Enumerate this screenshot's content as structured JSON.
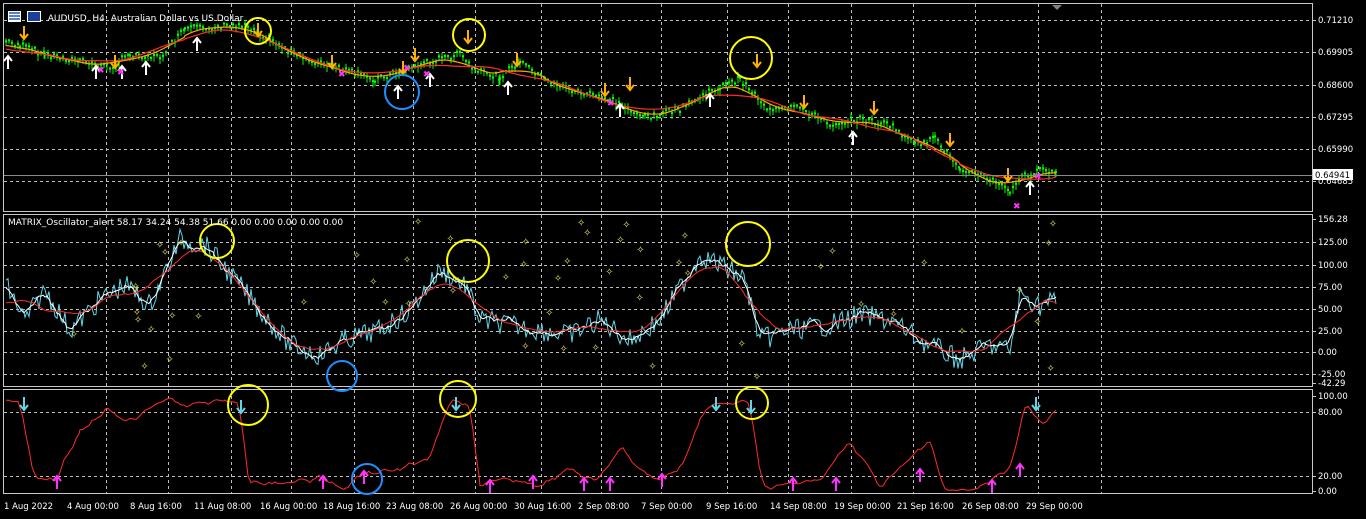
{
  "window": {
    "symbol_title": "AUDUSD, H4:  Australian Dollar vs US Dollar",
    "oscillator_title": "MATRIX_Oscillator_alert 58.17 34.24 54.38 51.66 0.00 0.00 0.00 0.00 0.00",
    "current_price": "0.64941"
  },
  "colors": {
    "background": "#000000",
    "grid": "#c8c8c8",
    "bull_candle": "#00ff00",
    "ma_red": "#ff2a2a",
    "ma_orange": "#ffa500",
    "arrow_down": "#ffb000",
    "arrow_up": "#ffffff",
    "cyan": "#5fd7e8",
    "magenta": "#ff33ff",
    "circle_yellow": "#ffff00",
    "circle_blue": "#1e90ff"
  },
  "price_axis": [
    "0.71210",
    "0.69905",
    "0.68600",
    "0.67295",
    "0.65990",
    "0.64685"
  ],
  "oscillator_axis": [
    "156.28",
    "125.00",
    "100.00",
    "75.00",
    "50.00",
    "25.00",
    "0.00",
    "-25.00",
    "-42.29"
  ],
  "stoch_axis": [
    "100.00",
    "80.00",
    "20.00",
    "0.00"
  ],
  "time_axis": [
    "1 Aug 2022",
    "4 Aug 00:00",
    "8 Aug 16:00",
    "11 Aug 08:00",
    "16 Aug 00:00",
    "18 Aug 16:00",
    "23 Aug 08:00",
    "26 Aug 00:00",
    "30 Aug 16:00",
    "2 Sep 08:00",
    "7 Sep 00:00",
    "9 Sep 16:00",
    "14 Sep 08:00",
    "19 Sep 00:00",
    "21 Sep 16:00",
    "26 Sep 08:00",
    "29 Sep 00:00"
  ]
}
